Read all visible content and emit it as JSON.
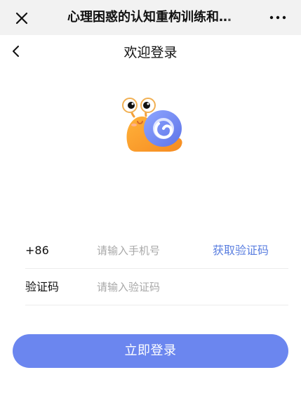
{
  "top_bar": {
    "title": "心理困惑的认知重构训练和…",
    "close_icon": "close-icon",
    "more_icon": "more-icon"
  },
  "header": {
    "back_icon": "chevron-left-icon",
    "title": "欢迎登录"
  },
  "mascot": {
    "icon": "snail-icon"
  },
  "form": {
    "phone_label": "+86",
    "phone_placeholder": "请输入手机号",
    "get_code_label": "获取验证码",
    "code_label": "验证码",
    "code_placeholder": "请输入验证码"
  },
  "actions": {
    "login_label": "立即登录"
  },
  "colors": {
    "accent": "#6b86ef",
    "link": "#5b7fe0",
    "topbar_bg": "#f2f2f2",
    "background": "#ffffff"
  }
}
